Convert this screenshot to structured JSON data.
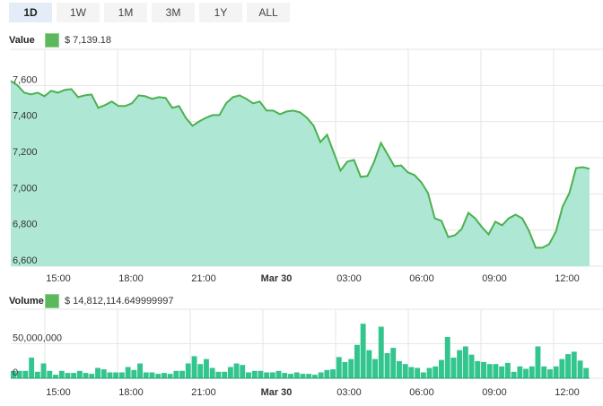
{
  "range_buttons": [
    {
      "label": "1D",
      "active": true
    },
    {
      "label": "1W",
      "active": false
    },
    {
      "label": "1M",
      "active": false
    },
    {
      "label": "3M",
      "active": false
    },
    {
      "label": "1Y",
      "active": false
    },
    {
      "label": "ALL",
      "active": false
    }
  ],
  "colors": {
    "line": "#4cb050",
    "area": "#aee8d4",
    "bars": "#33c58e",
    "legend_swatch": "#5cb85c",
    "active_button": "#e3ecf7",
    "grid": "#e6e6e6"
  },
  "chart_data": [
    {
      "type": "area",
      "title": "Value",
      "legend": {
        "label": "Value",
        "value": "$  7,139.18",
        "placement": "top-left"
      },
      "x_tick_labels": [
        "15:00",
        "18:00",
        "21:00",
        "Mar 30",
        "03:00",
        "06:00",
        "09:00",
        "12:00"
      ],
      "y_tick_labels": [
        "6,600",
        "6,800",
        "7,000",
        "7,200",
        "7,400",
        "7,600"
      ],
      "ylim": [
        6600,
        7800
      ],
      "grid": true,
      "x_range_hours": [
        "13:00",
        "12:55"
      ],
      "values": [
        7625,
        7600,
        7560,
        7550,
        7560,
        7540,
        7570,
        7560,
        7575,
        7580,
        7535,
        7545,
        7550,
        7476,
        7491,
        7511,
        7486,
        7486,
        7501,
        7545,
        7540,
        7526,
        7535,
        7531,
        7476,
        7486,
        7421,
        7377,
        7401,
        7421,
        7436,
        7436,
        7501,
        7535,
        7545,
        7526,
        7501,
        7511,
        7461,
        7461,
        7441,
        7456,
        7461,
        7451,
        7421,
        7377,
        7287,
        7327,
        7228,
        7129,
        7178,
        7188,
        7094,
        7099,
        7178,
        7282,
        7218,
        7153,
        7158,
        7119,
        7104,
        7064,
        7004,
        6865,
        6851,
        6761,
        6771,
        6806,
        6895,
        6865,
        6816,
        6776,
        6846,
        6826,
        6865,
        6885,
        6865,
        6796,
        6702,
        6702,
        6722,
        6791,
        6930,
        7004,
        7143,
        7148,
        7139
      ]
    },
    {
      "type": "bar",
      "title": "Volume",
      "legend": {
        "label": "Volume",
        "value": "$  14,812,114.649999997",
        "placement": "top-left"
      },
      "x_tick_labels": [
        "15:00",
        "18:00",
        "21:00",
        "Mar 30",
        "03:00",
        "06:00",
        "09:00",
        "12:00"
      ],
      "y_tick_labels": [
        "0",
        "50,000,000"
      ],
      "ylim": [
        0,
        100000000
      ],
      "grid": true,
      "values_millions": [
        10.7,
        10.7,
        10.7,
        29.9,
        9.4,
        21.4,
        10.7,
        5.1,
        10.7,
        7.7,
        7.7,
        10.7,
        7.7,
        6.4,
        14.9,
        12.8,
        8.5,
        8.5,
        8.5,
        16.2,
        12,
        21.4,
        8.5,
        8.5,
        6.4,
        7.7,
        6.4,
        10.7,
        10.7,
        21.4,
        32,
        20.5,
        27.8,
        14.9,
        9.4,
        9.4,
        16.2,
        21.4,
        19.2,
        8.5,
        10.7,
        10.7,
        8.5,
        8.5,
        10.7,
        7.7,
        6.4,
        8.5,
        6.4,
        6.4,
        5.1,
        8.5,
        12,
        12.8,
        30.7,
        23.5,
        27.8,
        48.3,
        79,
        40.6,
        27.8,
        74.7,
        36.3,
        44,
        24.8,
        20.5,
        16.2,
        14.9,
        8.5,
        14.9,
        17.1,
        26.5,
        59.8,
        29.9,
        40.6,
        46.1,
        34.2,
        24.8,
        23.5,
        20.5,
        20.5,
        17.1,
        22.2,
        9.4,
        17.1,
        13.7,
        17.1,
        46.1,
        17.1,
        12.8,
        17.1,
        27.8,
        35,
        38.4,
        25.6,
        14.8
      ]
    }
  ]
}
